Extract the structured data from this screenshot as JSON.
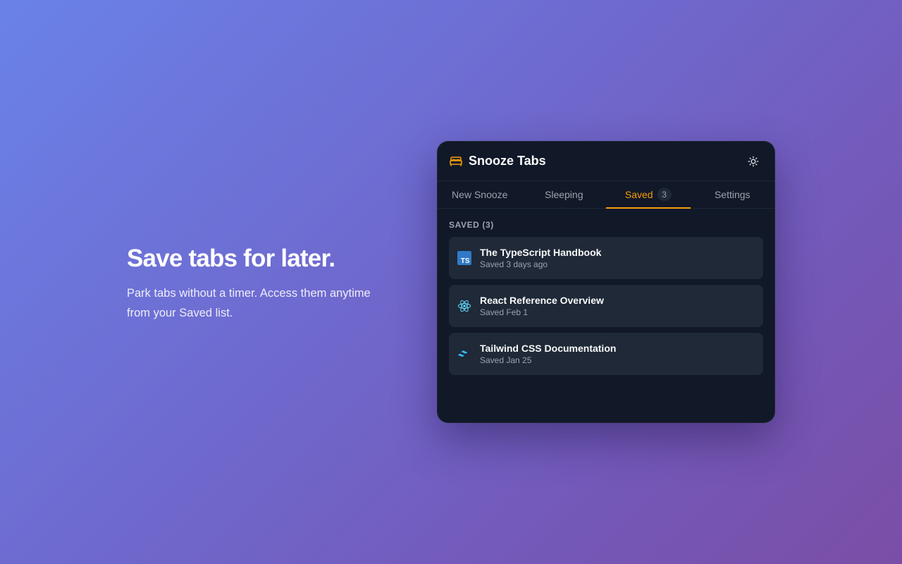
{
  "hero": {
    "title": "Save tabs for later.",
    "subtitle": "Park tabs without a timer. Access them anytime from your Saved list."
  },
  "popup": {
    "app_title": "Snooze Tabs",
    "brand_icon": "bed-icon",
    "theme_icon": "sun-icon",
    "tabs": [
      {
        "label": "New Snooze"
      },
      {
        "label": "Sleeping"
      },
      {
        "label": "Saved",
        "count": "3",
        "active": true
      },
      {
        "label": "Settings"
      }
    ],
    "section_label": "SAVED (3)",
    "items": [
      {
        "title": "The TypeScript Handbook",
        "meta": "Saved 3 days ago",
        "icon": "typescript-icon",
        "icon_text": "TS"
      },
      {
        "title": "React Reference Overview",
        "meta": "Saved Feb 1",
        "icon": "react-icon"
      },
      {
        "title": "Tailwind CSS Documentation",
        "meta": "Saved Jan 25",
        "icon": "tailwind-icon"
      }
    ]
  },
  "colors": {
    "accent": "#f59e0b",
    "panel_bg": "#111827",
    "card_bg": "#1f2937",
    "typescript": "#3178c6",
    "react": "#61dafb",
    "tailwind": "#38bdf8"
  }
}
